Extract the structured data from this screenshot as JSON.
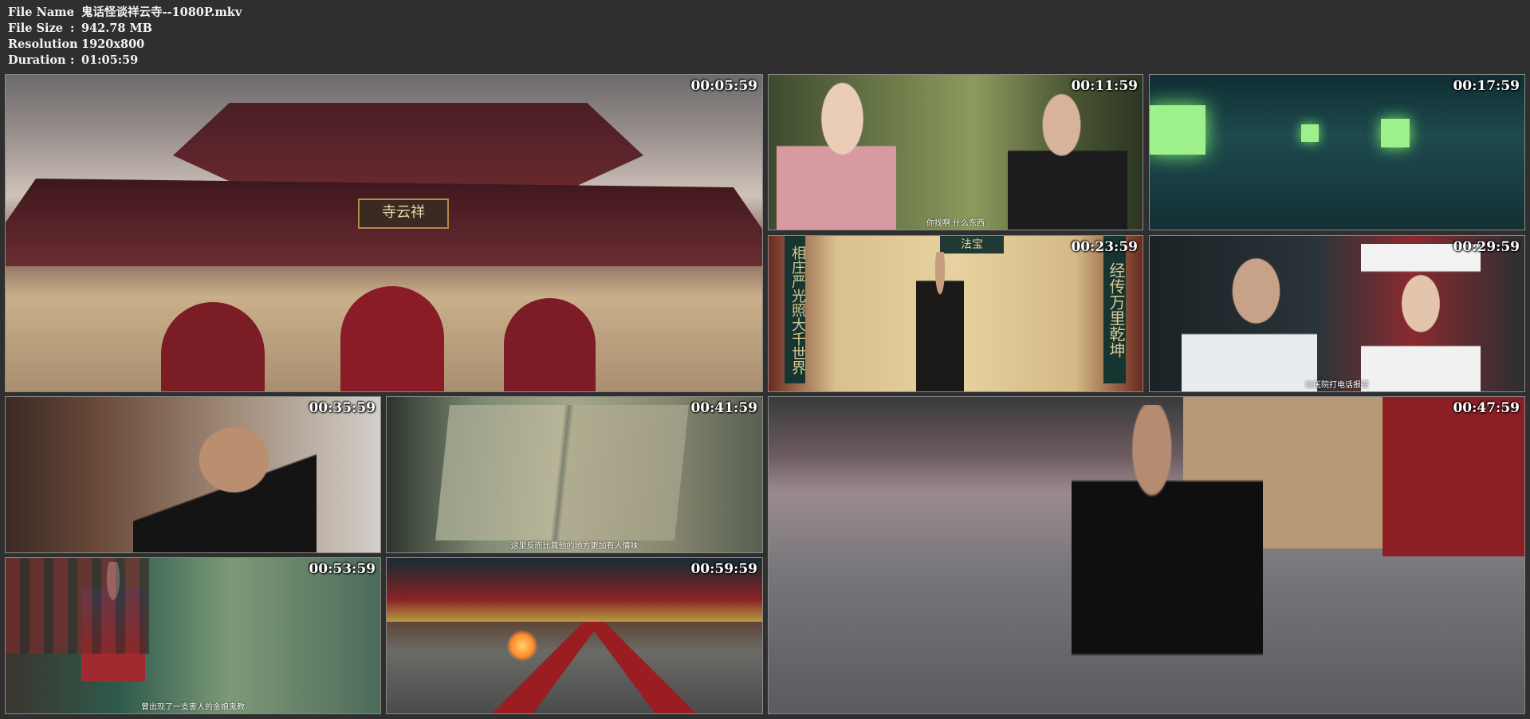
{
  "file_info": {
    "rows": [
      {
        "label": "File Name",
        "sep": ":",
        "value": "鬼话怪谈祥云寺--1080P.mkv"
      },
      {
        "label": "File Size",
        "sep": ":",
        "value": "942.78 MB"
      },
      {
        "label": "Resolution",
        "sep": ":",
        "value": "1920x800"
      },
      {
        "label": "Duration",
        "sep": ":",
        "value": "01:05:59"
      }
    ]
  },
  "thumbnails": [
    {
      "timestamp": "00:05:59",
      "subtitle": "",
      "sign_text": "寺云祥"
    },
    {
      "timestamp": "00:11:59",
      "subtitle": "你找啊  什么东西"
    },
    {
      "timestamp": "00:17:59",
      "subtitle": ""
    },
    {
      "timestamp": "00:23:59",
      "subtitle": "",
      "plaque_text": "法宝",
      "left_couplet": "相庄严光照大千世界",
      "right_couplet": "经传万里乾坤"
    },
    {
      "timestamp": "00:29:59",
      "subtitle": "给医院打电话报警"
    },
    {
      "timestamp": "00:35:59",
      "subtitle": ""
    },
    {
      "timestamp": "00:41:59",
      "subtitle": "这里反而比其他的地方更加有人情味"
    },
    {
      "timestamp": "00:47:59",
      "subtitle": ""
    },
    {
      "timestamp": "00:53:59",
      "subtitle": "曾出现了一支害人的金娘鬼教"
    },
    {
      "timestamp": "00:59:59",
      "subtitle": ""
    }
  ],
  "colors": {
    "background": "#2f2f2f",
    "text": "#f2f2f2",
    "tile_border": "#8a8a8a"
  }
}
